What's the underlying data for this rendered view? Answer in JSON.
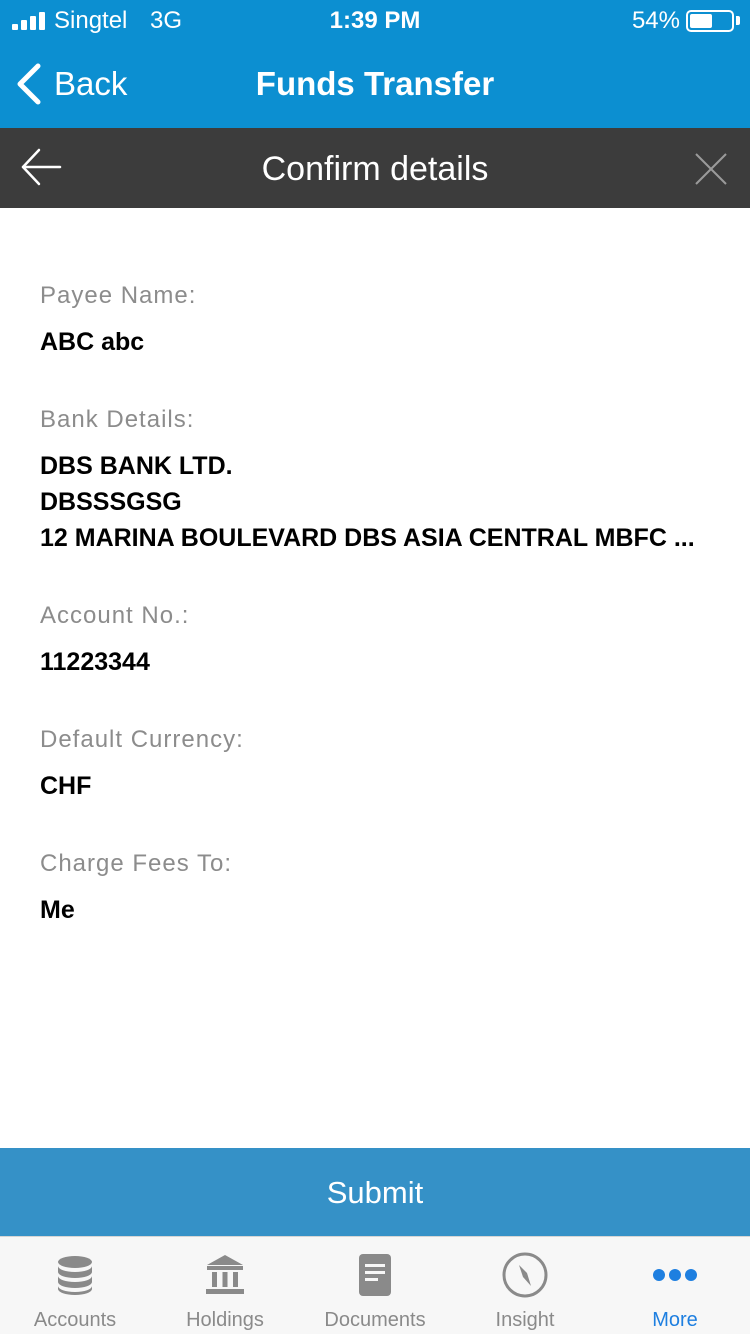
{
  "status_bar": {
    "carrier": "Singtel",
    "network": "3G",
    "time": "1:39 PM",
    "battery_percent": "54%",
    "battery_level": 0.54
  },
  "nav": {
    "back_label": "Back",
    "title": "Funds Transfer"
  },
  "sub_header": {
    "title": "Confirm details",
    "back_icon": "arrow-left-icon",
    "close_icon": "close-icon"
  },
  "details": {
    "payee_label": "Payee Name:",
    "payee_value": "ABC abc",
    "bank_label": "Bank Details:",
    "bank_name": "DBS BANK LTD.",
    "bank_swift": "DBSSSGSG",
    "bank_address": "12 MARINA BOULEVARD DBS ASIA CENTRAL MBFC ...",
    "account_label": "Account No.:",
    "account_value": "11223344",
    "currency_label": "Default Currency:",
    "currency_value": "CHF",
    "fees_label": "Charge Fees To:",
    "fees_value": "Me"
  },
  "submit_label": "Submit",
  "tabs": [
    {
      "label": "Accounts",
      "icon": "database-icon",
      "active": false
    },
    {
      "label": "Holdings",
      "icon": "bank-icon",
      "active": false
    },
    {
      "label": "Documents",
      "icon": "document-icon",
      "active": false
    },
    {
      "label": "Insight",
      "icon": "compass-icon",
      "active": false
    },
    {
      "label": "More",
      "icon": "more-dots-icon",
      "active": true
    }
  ],
  "colors": {
    "header_blue": "#0c8fd1",
    "sub_header_dark": "#3c3c3c",
    "submit_blue": "#3591c7",
    "tab_active": "#1e7fe0",
    "tab_inactive": "#8a8a8a"
  }
}
